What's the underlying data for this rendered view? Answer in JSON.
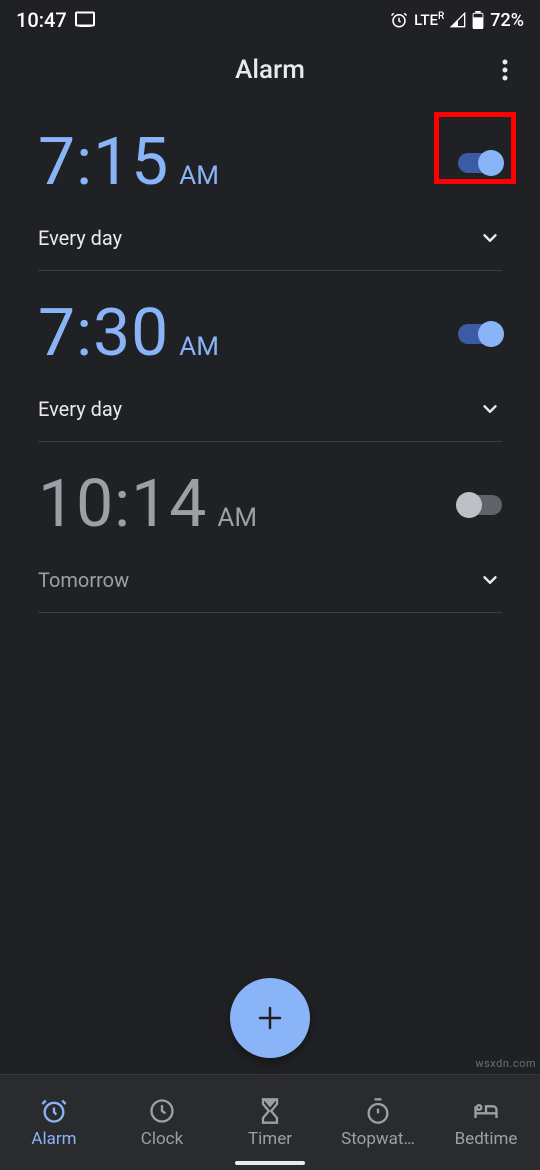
{
  "statusbar": {
    "time": "10:47",
    "network": "LTE",
    "network_sup": "R",
    "battery": "72%"
  },
  "header": {
    "title": "Alarm"
  },
  "alarms": [
    {
      "time": "7:15",
      "suffix": "AM",
      "label": "Every day",
      "enabled": true,
      "highlighted": true
    },
    {
      "time": "7:30",
      "suffix": "AM",
      "label": "Every day",
      "enabled": true,
      "highlighted": false
    },
    {
      "time": "10:14",
      "suffix": "AM",
      "label": "Tomorrow",
      "enabled": false,
      "highlighted": false
    }
  ],
  "nav": [
    {
      "id": "alarm",
      "label": "Alarm",
      "active": true
    },
    {
      "id": "clock",
      "label": "Clock",
      "active": false
    },
    {
      "id": "timer",
      "label": "Timer",
      "active": false
    },
    {
      "id": "stopwatch",
      "label": "Stopwat…",
      "active": false
    },
    {
      "id": "bedtime",
      "label": "Bedtime",
      "active": false
    }
  ],
  "watermark": "wsxdn.com"
}
